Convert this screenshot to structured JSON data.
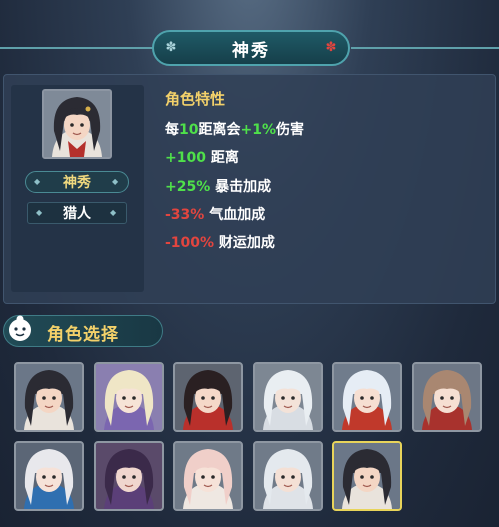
{
  "title": "神秀",
  "character": {
    "name": "神秀",
    "job": "猎人",
    "trait_title": "角色特性",
    "traits": [
      {
        "parts": [
          "每",
          "10",
          "距离会",
          "+1%",
          "伤害"
        ]
      },
      {
        "parts": [
          "+100",
          " 距离"
        ]
      },
      {
        "parts": [
          "+25%",
          " 暴击加成"
        ]
      },
      {
        "parts": [
          "-33%",
          " 气血加成"
        ]
      },
      {
        "parts": [
          "-100%",
          " 财运加成"
        ]
      }
    ]
  },
  "section_label": "角色选择",
  "colors": {
    "accent_gold": "#f3d16a",
    "positive": "#4fe04a",
    "negative": "#e2453f",
    "selected_border": "#e8d45a"
  },
  "roster": [
    {
      "id": "char-1",
      "hair": "#2b2b33",
      "bg": "#6b7788",
      "skin": "#f4d6c4",
      "cloth": "#e9e3dc",
      "selected": false
    },
    {
      "id": "char-2",
      "hair": "#efe6c6",
      "bg": "#8a7fb0",
      "skin": "#f6e3d6",
      "cloth": "#7b66b0",
      "selected": false
    },
    {
      "id": "char-3",
      "hair": "#2a2022",
      "bg": "#5d6470",
      "skin": "#f5d8c8",
      "cloth": "#b9302b",
      "selected": false
    },
    {
      "id": "char-4",
      "hair": "#e9eef2",
      "bg": "#7d8793",
      "skin": "#f3e2d8",
      "cloth": "#d8dde3",
      "selected": false
    },
    {
      "id": "char-5",
      "hair": "#e6edf5",
      "bg": "#707c8c",
      "skin": "#f6dfd2",
      "cloth": "#c0392b",
      "selected": false
    },
    {
      "id": "char-6",
      "hair": "#a98771",
      "bg": "#6d7786",
      "skin": "#f6dfd2",
      "cloth": "#a8322d",
      "selected": false
    },
    {
      "id": "char-7",
      "hair": "#e8e8ec",
      "bg": "#5b6676",
      "skin": "#f6e2d8",
      "cloth": "#2f6fb0",
      "selected": false
    },
    {
      "id": "char-8",
      "hair": "#3b2a4a",
      "bg": "#5a4a6a",
      "skin": "#f0d6ce",
      "cloth": "#5b3f78",
      "selected": false
    },
    {
      "id": "char-9",
      "hair": "#f0cfc9",
      "bg": "#6f7a88",
      "skin": "#f6e2d8",
      "cloth": "#efe8e2",
      "selected": false
    },
    {
      "id": "char-10",
      "hair": "#e4e9ee",
      "bg": "#707b89",
      "skin": "#f4e0d5",
      "cloth": "#dfe3e8",
      "selected": false
    },
    {
      "id": "char-11",
      "hair": "#2b2b33",
      "bg": "#6b7788",
      "skin": "#f4d6c4",
      "cloth": "#e9e3dc",
      "selected": true
    }
  ]
}
